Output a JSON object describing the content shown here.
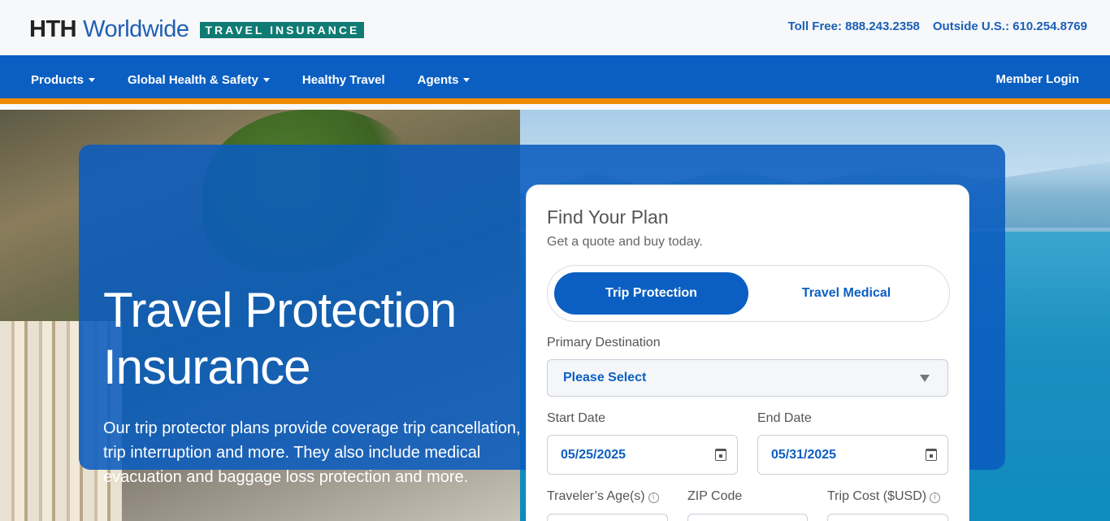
{
  "header": {
    "logo_hth": "HTH",
    "logo_worldwide": "Worldwide",
    "logo_tagline": "TRAVEL INSURANCE",
    "toll_free": "Toll Free: 888.243.2358",
    "outside_us": "Outside U.S.: 610.254.8769"
  },
  "nav": {
    "items": [
      {
        "label": "Products",
        "dropdown": true
      },
      {
        "label": "Global Health & Safety",
        "dropdown": true
      },
      {
        "label": "Healthy Travel",
        "dropdown": false
      },
      {
        "label": "Agents",
        "dropdown": true
      }
    ],
    "member_login": "Member Login"
  },
  "hero": {
    "title": "Travel Protection Insurance",
    "description": "Our trip protector plans provide coverage trip cancellation, trip interruption and more. They also include medical evacuation and baggage loss protection and more."
  },
  "plan": {
    "title": "Find Your Plan",
    "subtitle": "Get a quote and buy today.",
    "tabs": {
      "active": "Trip Protection",
      "inactive": "Travel Medical"
    },
    "destination_label": "Primary Destination",
    "destination_value": "Please Select",
    "start_label": "Start Date",
    "start_value": "05/25/2025",
    "end_label": "End Date",
    "end_value": "05/31/2025",
    "age_label": "Traveler’s Age(s)",
    "zip_label": "ZIP Code",
    "cost_label": "Trip Cost ($USD)"
  },
  "colors": {
    "brand_blue": "#0b5fc2",
    "accent_orange": "#f08c00",
    "tagline_green": "#0f7b73"
  }
}
